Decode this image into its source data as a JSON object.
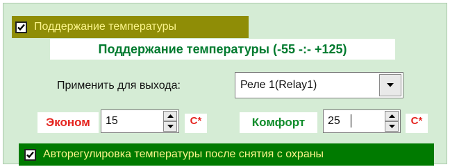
{
  "group": {
    "checked": true,
    "label": "Поддержание температуры"
  },
  "title": "Поддержание температуры (-55 -:- +125)",
  "apply": {
    "label": "Применить для выхода:",
    "selected": "Реле 1(Relay1)"
  },
  "econom": {
    "label": "Эконом",
    "value": "15",
    "unit": "C*"
  },
  "comfort": {
    "label": "Комфорт",
    "value": "25",
    "unit": "C*"
  },
  "auto": {
    "checked": true,
    "label": "Авторегулировка температуры после снятия с охраны"
  },
  "colors": {
    "panel_bg": "#d5ecd5",
    "header_bg": "#8f8d06",
    "header_text": "#fbf48a",
    "title_text": "#007a2e",
    "red": "#e5231e",
    "green": "#0f8c2a",
    "auto_bg": "#007a00"
  }
}
